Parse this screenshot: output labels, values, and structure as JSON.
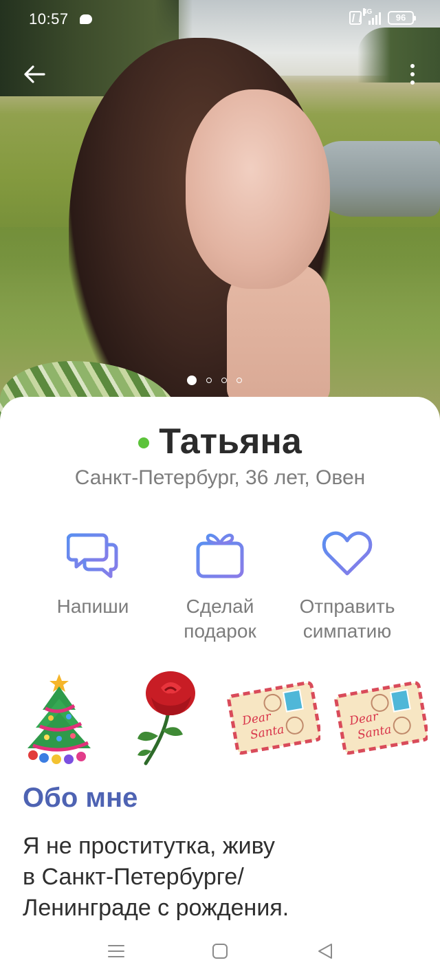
{
  "status_bar": {
    "time": "10:57",
    "signal_tag": "4G",
    "battery": "96"
  },
  "profile": {
    "name": "Татьяна",
    "online": true,
    "subtitle": "Санкт-Петербург, 36 лет, Овен",
    "photo_count": 4,
    "active_photo": 1
  },
  "actions": [
    {
      "icon": "chat-icon",
      "line1": "Напиши",
      "line2": ""
    },
    {
      "icon": "gift-icon",
      "line1": "Сделай",
      "line2": "подарок"
    },
    {
      "icon": "heart-icon",
      "line1": "Отправить",
      "line2": "симпатию"
    }
  ],
  "gifts": [
    {
      "icon": "christmas-tree-icon"
    },
    {
      "icon": "rose-icon"
    },
    {
      "icon": "dear-santa-letter-icon",
      "text_1": "Dear",
      "text_2": "Santa"
    },
    {
      "icon": "dear-santa-letter-icon",
      "text_1": "Dear",
      "text_2": "Santa"
    }
  ],
  "about": {
    "title": "Обо мне",
    "line1": "Я не проститутка, живу",
    "line2": "в Санкт-Петербурге/",
    "line3": "Ленинграде с рождения."
  },
  "colors": {
    "accent": "#4e63b3",
    "online": "#5cc33a",
    "icon_gradient_start": "#5a8ff0",
    "icon_gradient_end": "#8a7be8"
  }
}
